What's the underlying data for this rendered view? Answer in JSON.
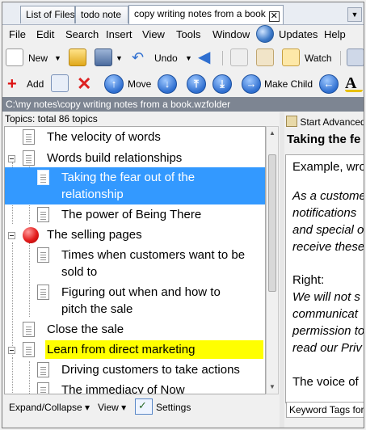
{
  "tabs": [
    {
      "label": "List of Files"
    },
    {
      "label": "todo note"
    },
    {
      "label": "copy writing notes from a book",
      "close": "✕"
    }
  ],
  "menu": [
    "File",
    "Edit",
    "Search",
    "Insert",
    "View",
    "Tools",
    "Window",
    "Updates",
    "Help"
  ],
  "toolbar1": {
    "new": "New",
    "undo": "Undo",
    "watch": "Watch"
  },
  "toolbar2": {
    "add": "Add",
    "move": "Move",
    "make_child": "Make Child"
  },
  "path": "C:\\my notes\\copy writing notes from a book.wzfolder",
  "topics_label": "Topics: total 86 topics",
  "tree": [
    {
      "text": "The velocity of words"
    },
    {
      "text": "Words build relationships"
    },
    {
      "text": "Taking the fear out of the",
      "text2": "relationship",
      "selected": true
    },
    {
      "text": "The power of Being There"
    },
    {
      "text": "The selling pages"
    },
    {
      "text": "Times when customers want to be",
      "text2": "sold to"
    },
    {
      "text": "Figuring out when and how to",
      "text2": "pitch the sale"
    },
    {
      "text": "Close the sale"
    },
    {
      "text": "Learn from direct marketing",
      "highlight": "#ffff00"
    },
    {
      "text": "Driving customers to take actions"
    },
    {
      "text": "The immediacy of Now"
    }
  ],
  "bottom": {
    "expand": "Expand/Collapse ▾",
    "view": "View ▾",
    "settings": "Settings"
  },
  "right": {
    "toolbar": "Start Advanced",
    "title": "Taking the fe",
    "lines": [
      {
        "text": "Example, wro",
        "italic": false
      },
      {
        "text": "As a custome",
        "italic": true
      },
      {
        "text": "notifications",
        "italic": true
      },
      {
        "text": "and special o",
        "italic": true
      },
      {
        "text": "receive these",
        "italic": true
      },
      {
        "text": "Right:",
        "italic": false
      },
      {
        "text": "We will not s",
        "italic": true
      },
      {
        "text": "communicat",
        "italic": true
      },
      {
        "text": "permission to",
        "italic": true
      },
      {
        "text": "read our Priv",
        "italic": true
      },
      {
        "text": "The voice of",
        "italic": false
      }
    ],
    "tags": "Keyword Tags for"
  }
}
